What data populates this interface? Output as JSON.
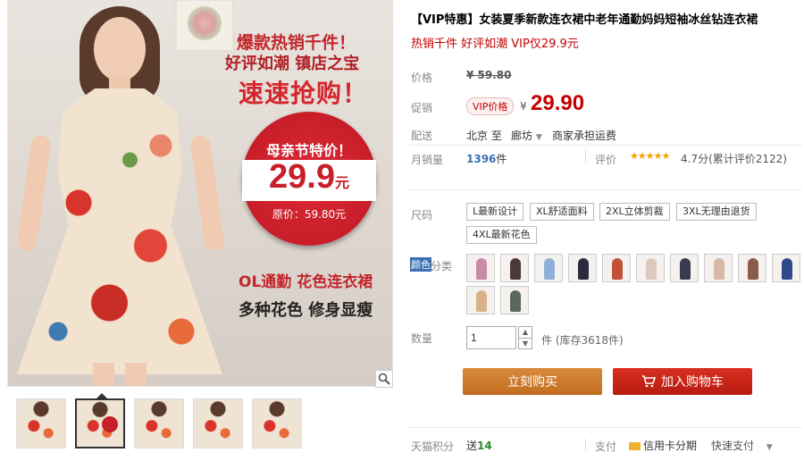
{
  "product_image": {
    "headline_1": "爆款热销千件！",
    "headline_2": "好评如潮  镇店之宝",
    "headline_3": "速速抢购！",
    "circle_title": "母亲节特价！",
    "circle_price": "29.9",
    "circle_price_unit": "元",
    "circle_original": "原价：59.80元",
    "tagline_1": "OL通勤  花色连衣裙",
    "tagline_2": "多种花色  修身显瘦",
    "zoom_icon": "magnifier-icon"
  },
  "thumbnails": [
    {
      "active": false
    },
    {
      "active": true,
      "badge": "29.9"
    },
    {
      "active": false
    },
    {
      "active": false
    },
    {
      "active": false
    }
  ],
  "product": {
    "title": "【VIP特惠】女装夏季新款连衣裙中老年通勤妈妈短袖冰丝钻连衣裙",
    "subtitle": "热销千件  好评如潮  VIP仅29.9元"
  },
  "price": {
    "label": "价格",
    "original": "¥ 59.80"
  },
  "promo": {
    "label": "促销",
    "tag": "VIP价格",
    "currency": "¥",
    "amount": "29.90"
  },
  "shipping": {
    "label": "配送",
    "from": "北京  至",
    "to": "廊坊",
    "dropdown_icon": "chevron-down-icon",
    "carrier": "商家承担运费"
  },
  "stats": {
    "sales_label": "月销量",
    "sales_value": "1396",
    "sales_unit": "件",
    "rating_label": "评价",
    "stars": "★★★★★",
    "rating_text": "4.7分(累计评价2122)"
  },
  "size": {
    "label": "尺码",
    "options": [
      "L最新设计",
      "XL舒适面料",
      "2XL立体剪裁",
      "3XL无理由退货",
      "4XL最新花色"
    ]
  },
  "color": {
    "label_highlight": "颜色",
    "label_rest": "分类",
    "swatches": [
      "#c98aa8",
      "#4a3b3a",
      "#8fb0d8",
      "#2c2a40",
      "#c4503a",
      "#ddc8c0",
      "#3b3b50",
      "#d7b9a8",
      "#8a5a4a",
      "#2f4a8a",
      "#4a63a8",
      "#d9b08a",
      "#5a6a5a"
    ]
  },
  "quantity": {
    "label": "数量",
    "value": "1",
    "unit_stock": "件 (库存3618件)"
  },
  "actions": {
    "buy_now": "立刻购买",
    "add_cart": "加入购物车",
    "cart_icon": "cart-icon"
  },
  "footer": {
    "points_label": "天猫积分",
    "points_prefix": "送",
    "points_value": "14",
    "pay_label": "支付",
    "credit_card": "信用卡分期",
    "quick_pay": "快速支付"
  },
  "colors": {
    "accent_red": "#c40000",
    "buy_orange": "#cf7c2c",
    "cart_red": "#c4241a",
    "link_blue": "#3c6fb0"
  }
}
